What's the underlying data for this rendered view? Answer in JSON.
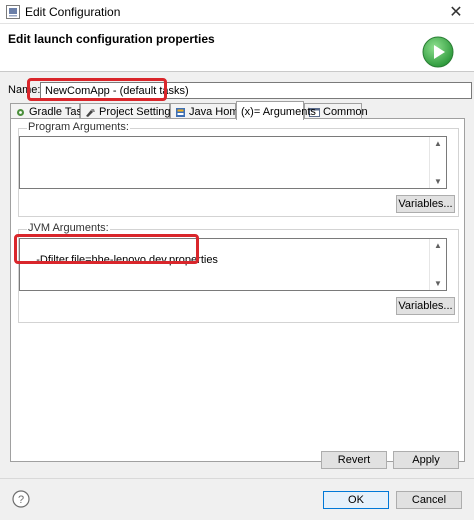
{
  "window": {
    "title": "Edit Configuration",
    "close_glyph": "✕",
    "app_icon": "eclipse-icon"
  },
  "header": {
    "title": "Edit launch configuration properties",
    "icon": "run-icon"
  },
  "name_field": {
    "label_before": "Na",
    "label_after": "e:",
    "value": "NewComApp - (default tasks)"
  },
  "tabs": [
    {
      "label": "Gradle Tasks",
      "icon": "gradle-icon"
    },
    {
      "label": "Project Settings",
      "icon": "settings-icon"
    },
    {
      "label": "Java Home",
      "icon": "java-icon"
    },
    {
      "label": "(x)= Arguments",
      "icon": "arguments-icon",
      "active": true
    },
    {
      "label": "Common",
      "icon": "common-icon"
    }
  ],
  "program_arguments": {
    "label": "Program Arguments:",
    "value": "",
    "variables_label": "Variables..."
  },
  "jvm_arguments": {
    "label": "JVM Arguments:",
    "value": "-Dfilter.file=hhe-lenovo.dev.properties",
    "variables_label": "Variables..."
  },
  "actions": {
    "revert_label": "Revert",
    "apply_label": "Apply",
    "ok_label": "OK",
    "cancel_label": "Cancel"
  },
  "colors": {
    "highlight": "#d9262b",
    "run_icon": "#3aa84a",
    "accent": "#0078d7"
  }
}
